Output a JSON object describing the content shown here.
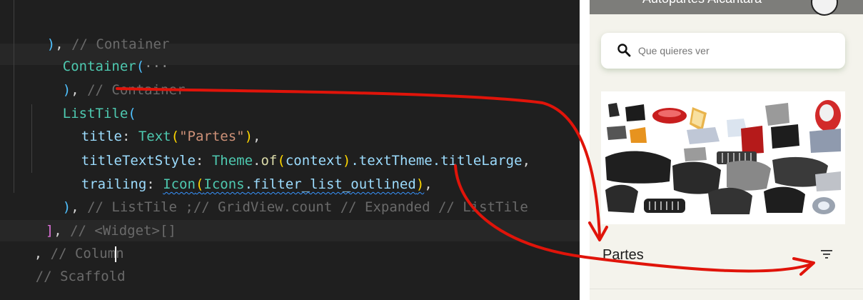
{
  "editor": {
    "lines": [
      {
        "indent": "  ",
        "close": ")",
        "close_class": "br1",
        "comma": ",",
        "comment": " // Container"
      },
      {
        "indent": "  ",
        "name": "Container",
        "open": "(",
        "dots": "···"
      },
      {
        "indent": "  ",
        "close": ")",
        "close_class": "br1",
        "comma": ",",
        "comment": " // Container"
      },
      {
        "indent": "  ",
        "name": "ListTile",
        "open": "("
      },
      {
        "indent": "    ",
        "prop": "title",
        "colon": ": ",
        "cls": "Text",
        "open": "(",
        "str": "\"Partes\"",
        "close": ")",
        "comma": ","
      },
      {
        "indent": "    ",
        "prop": "titleTextStyle",
        "colon": ": ",
        "cls": "Theme",
        "dot1": ".",
        "fn": "of",
        "open": "(",
        "arg": "context",
        "close": ")",
        "rest": ".textTheme.titleLarge",
        "comma": ","
      },
      {
        "indent": "    ",
        "prop": "trailing",
        "colon": ": ",
        "cls": "Icon",
        "open": "(",
        "arg": "Icons",
        "rest": ".filter_list_outlined",
        "close": ")",
        "comma": ","
      },
      {
        "indent": "  ",
        "close": ")",
        "comma": ",",
        "comment": " // ListTile ;// GridView.count // Expanded // ListTile"
      },
      {
        "indent": " ",
        "close": "]",
        "comma": ",",
        "comment": " // <Widget>[]"
      },
      {
        "indent": "",
        "pre": ",",
        "comment_a": " // Colum",
        "comment_b": "n"
      },
      {
        "indent": "",
        "comment": "// Scaffold"
      }
    ]
  },
  "app": {
    "appbar_title": "Autopartes Alcantara",
    "search_placeholder": "Que quieres ver",
    "tile_title": "Partes",
    "icons": {
      "search": "search-icon",
      "trailing": "filter-list-icon"
    },
    "colors": {
      "appbar": "#7d7d7a",
      "background": "#f4f3ec",
      "annotation": "#e0140a"
    }
  }
}
